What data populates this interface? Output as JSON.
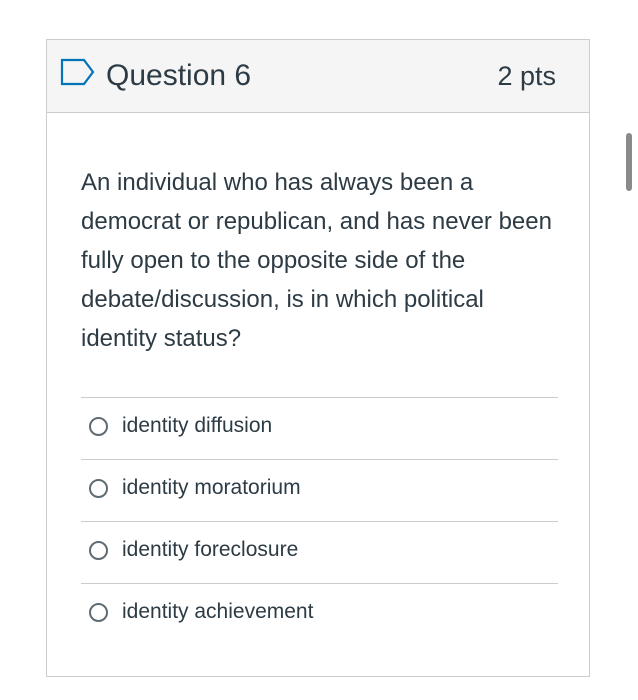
{
  "question": {
    "title": "Question 6",
    "points": "2 pts",
    "text": "An individual who has always been a democrat or republican, and has never been fully open to the opposite side of the debate/discussion, is in which political identity status?",
    "flag_icon": "bookmark-flag-icon",
    "answers": [
      {
        "label": "identity diffusion",
        "selected": false
      },
      {
        "label": "identity moratorium",
        "selected": false
      },
      {
        "label": "identity foreclosure",
        "selected": false
      },
      {
        "label": "identity achievement",
        "selected": false
      }
    ]
  },
  "colors": {
    "header_bg": "#f5f5f5",
    "border": "#c7cdd1",
    "text": "#2d3b45",
    "flag": "#0374b5"
  }
}
